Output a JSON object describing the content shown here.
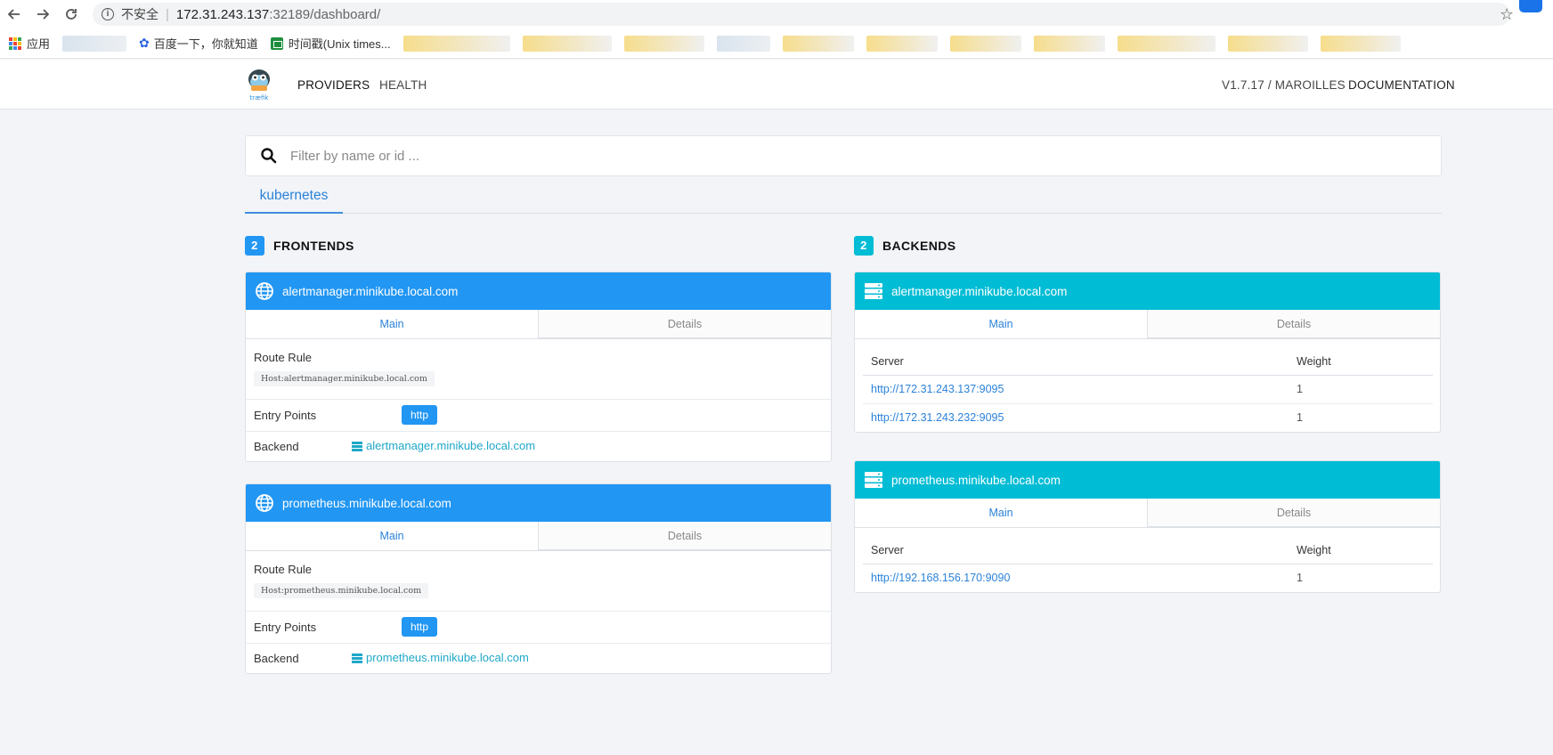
{
  "browser": {
    "security_label": "不安全",
    "url_host": "172.31.243.137",
    "url_path": ":32189/dashboard/",
    "bookmarks": {
      "apps": "应用",
      "baidu": "百度一下，你就知道",
      "unix": "时间戳(Unix times..."
    }
  },
  "header": {
    "logo_text": "træfik",
    "nav_providers": "PROVIDERS",
    "nav_health": "HEALTH",
    "version": "V1.7.17 / MAROILLES",
    "documentation": "DOCUMENTATION"
  },
  "filter": {
    "placeholder": "Filter by name or id ..."
  },
  "provider_tabs": [
    "kubernetes"
  ],
  "tab_labels": {
    "main": "Main",
    "details": "Details"
  },
  "frontends": {
    "count": "2",
    "title": "FRONTENDS",
    "route_rule_label": "Route Rule",
    "entry_points_label": "Entry Points",
    "backend_label": "Backend",
    "items": [
      {
        "name": "alertmanager.minikube.local.com",
        "rule": "Host:alertmanager.minikube.local.com",
        "entry_point": "http",
        "backend": "alertmanager.minikube.local.com"
      },
      {
        "name": "prometheus.minikube.local.com",
        "rule": "Host:prometheus.minikube.local.com",
        "entry_point": "http",
        "backend": "prometheus.minikube.local.com"
      }
    ]
  },
  "backends": {
    "count": "2",
    "title": "BACKENDS",
    "server_header": "Server",
    "weight_header": "Weight",
    "items": [
      {
        "name": "alertmanager.minikube.local.com",
        "servers": [
          {
            "url": "http://172.31.243.137:9095",
            "weight": "1"
          },
          {
            "url": "http://172.31.243.232:9095",
            "weight": "1"
          }
        ]
      },
      {
        "name": "prometheus.minikube.local.com",
        "servers": [
          {
            "url": "http://192.168.156.170:9090",
            "weight": "1"
          }
        ]
      }
    ]
  }
}
